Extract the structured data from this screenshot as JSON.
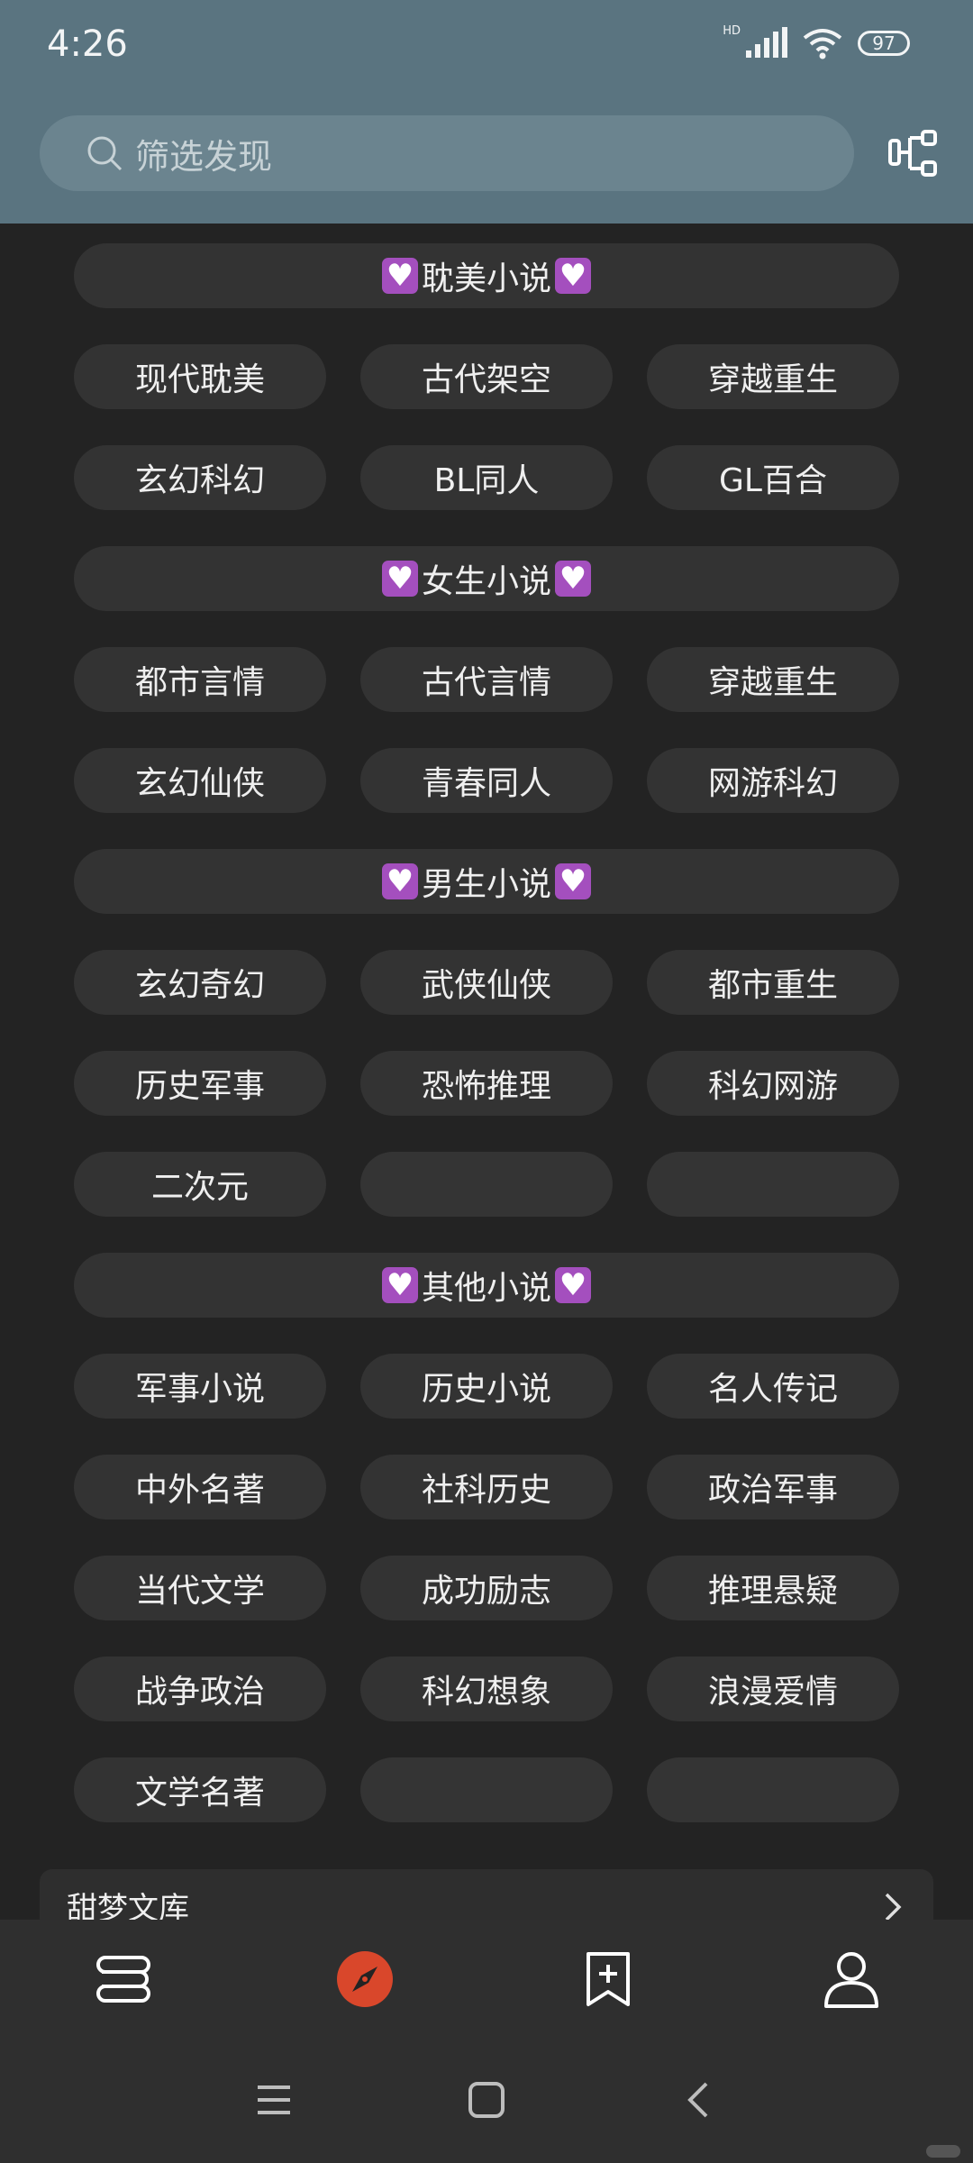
{
  "status_bar": {
    "time": "4:26",
    "network_label": "HD",
    "battery": "97"
  },
  "search": {
    "placeholder": "筛选发现"
  },
  "sections": [
    {
      "title": "耽美小说",
      "chips": [
        "现代耽美",
        "古代架空",
        "穿越重生",
        "玄幻科幻",
        "BL同人",
        "GL百合"
      ]
    },
    {
      "title": "女生小说",
      "chips": [
        "都市言情",
        "古代言情",
        "穿越重生",
        "玄幻仙侠",
        "青春同人",
        "网游科幻"
      ]
    },
    {
      "title": "男生小说",
      "chips": [
        "玄幻奇幻",
        "武侠仙侠",
        "都市重生",
        "历史军事",
        "恐怖推理",
        "科幻网游",
        "二次元",
        "",
        ""
      ]
    },
    {
      "title": "其他小说",
      "chips": [
        "军事小说",
        "历史小说",
        "名人传记",
        "中外名著",
        "社科历史",
        "政治军事",
        "当代文学",
        "成功励志",
        "推理悬疑",
        "战争政治",
        "科幻想象",
        "浪漫爱情",
        "文学名著",
        "",
        ""
      ]
    }
  ],
  "source_card": {
    "label": "甜梦文库"
  },
  "bottom_nav": {
    "items": [
      {
        "icon": "bookshelf-icon"
      },
      {
        "icon": "compass-icon",
        "active": true
      },
      {
        "icon": "bookmark-add-icon"
      },
      {
        "icon": "profile-icon"
      }
    ],
    "active_color": "#d9472b"
  },
  "colors": {
    "header_bg": "#5a7480",
    "page_bg": "#232323",
    "chip_bg": "#333333",
    "heart_badge": "#a44fbe"
  }
}
